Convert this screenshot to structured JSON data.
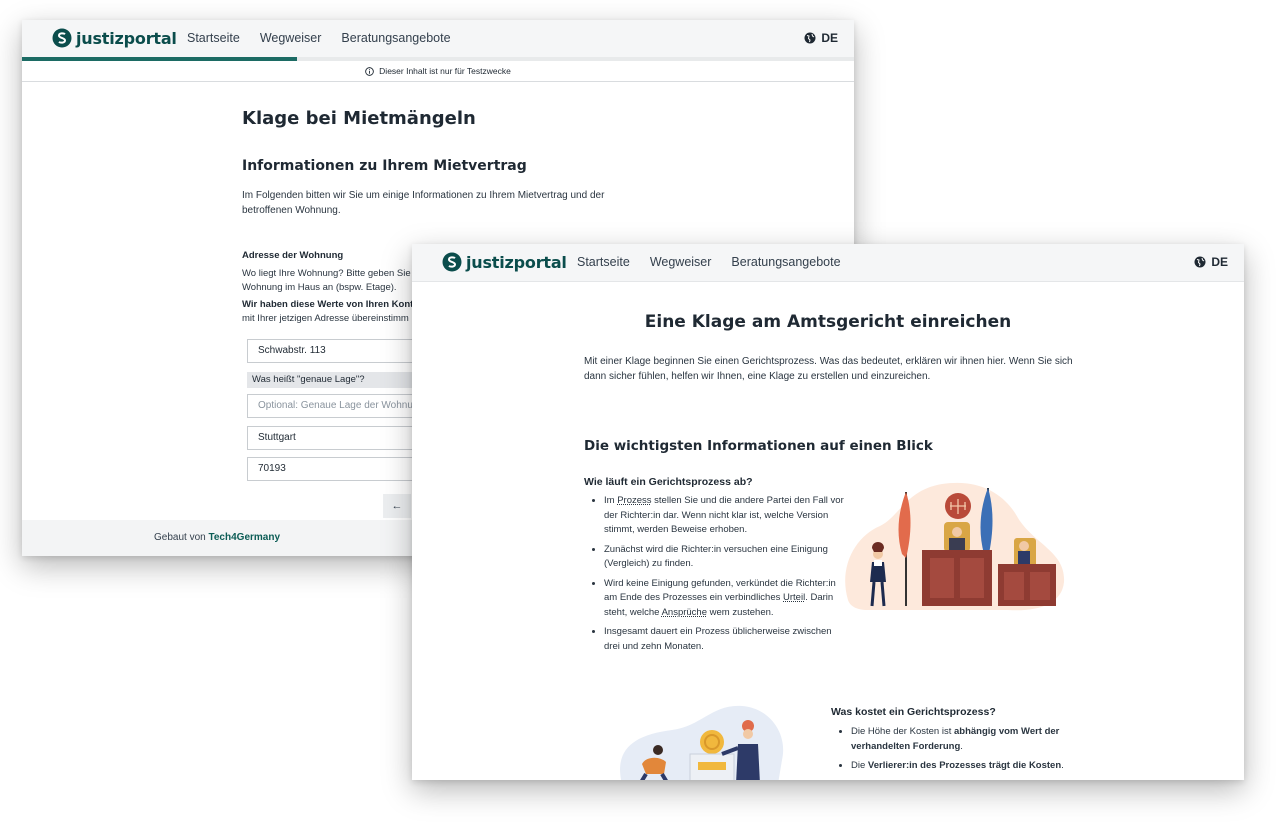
{
  "brand": {
    "name": "justizportal"
  },
  "nav": {
    "items": [
      "Startseite",
      "Wegweiser",
      "Beratungsangebote"
    ],
    "language": "DE"
  },
  "colors": {
    "brand": "#0b4d4c",
    "progress": "#1c6b64",
    "illustration_bg": "#fde9dc"
  },
  "back_window": {
    "progress_fraction": 0.33,
    "test_notice": "Dieser Inhalt ist nur für Testzwecke",
    "title": "Klage bei Mietmängeln",
    "subtitle": "Informationen zu Ihrem Mietvertrag",
    "intro": "Im Folgenden bitten wir Sie um einige Informationen zu Ihrem Mietvertrag und der betroffenen Wohnung.",
    "address_label": "Adresse der Wohnung",
    "address_help_line1": "Wo liegt Ihre Wohnung? Bitte geben Sie",
    "address_help_line2": "Wohnung im Haus an (bspw. Etage).",
    "address_help_bold": "Wir haben diese Werte von Ihren Konta",
    "address_help_line4": "mit Ihrer jetzigen Adresse übereinstimm",
    "street_value": "Schwabstr. 113",
    "lage_tooltip": "Was heißt \"genaue Lage\"?",
    "lage_placeholder": "Optional: Genaue Lage der Wohnung",
    "city_value": "Stuttgart",
    "zip_value": "70193",
    "back_arrow": "←",
    "footer_text": "Gebaut von",
    "footer_link": "Tech4Germany"
  },
  "front_window": {
    "title": "Eine Klage am Amtsgericht einreichen",
    "intro": "Mit einer Klage beginnen Sie einen Gerichtsprozess. Was das bedeutet, erklären wir ihnen hier. Wenn Sie sich dann sicher fühlen, helfen wir Ihnen, eine Klage zu erstellen und einzureichen.",
    "section_heading": "Die wichtigsten Informationen auf einen Blick",
    "q1": {
      "heading": "Wie läuft ein Gerichtsprozess ab?",
      "b1_pre": "Im",
      "b1_term": "Prozess",
      "b1_post": "stellen Sie und die andere Partei den Fall vor der Richter:in dar. Wenn nicht klar ist, welche Version stimmt, werden Beweise erhoben.",
      "b2": "Zunächst wird die Richter:in versuchen eine Einigung (Vergleich) zu finden.",
      "b3_pre": "Wird keine Einigung gefunden, verkündet die Richter:in am Ende des Prozesses ein verbindliches",
      "b3_term1": "Urteil",
      "b3_mid": ". Darin steht, welche",
      "b3_term2": "Ansprüche",
      "b3_post": "wem zustehen.",
      "b4": "Insgesamt dauert ein Prozess üblicherweise zwischen drei und zehn Monaten."
    },
    "q2": {
      "heading": "Was kostet ein Gerichtsprozess?",
      "b1_pre": "Die Höhe der Kosten ist",
      "b1_bold": "abhängig vom Wert der verhandelten Forderung",
      "b2_pre": "Die",
      "b2_bold": "Verlierer:in des Prozesses trägt die Kosten"
    }
  }
}
